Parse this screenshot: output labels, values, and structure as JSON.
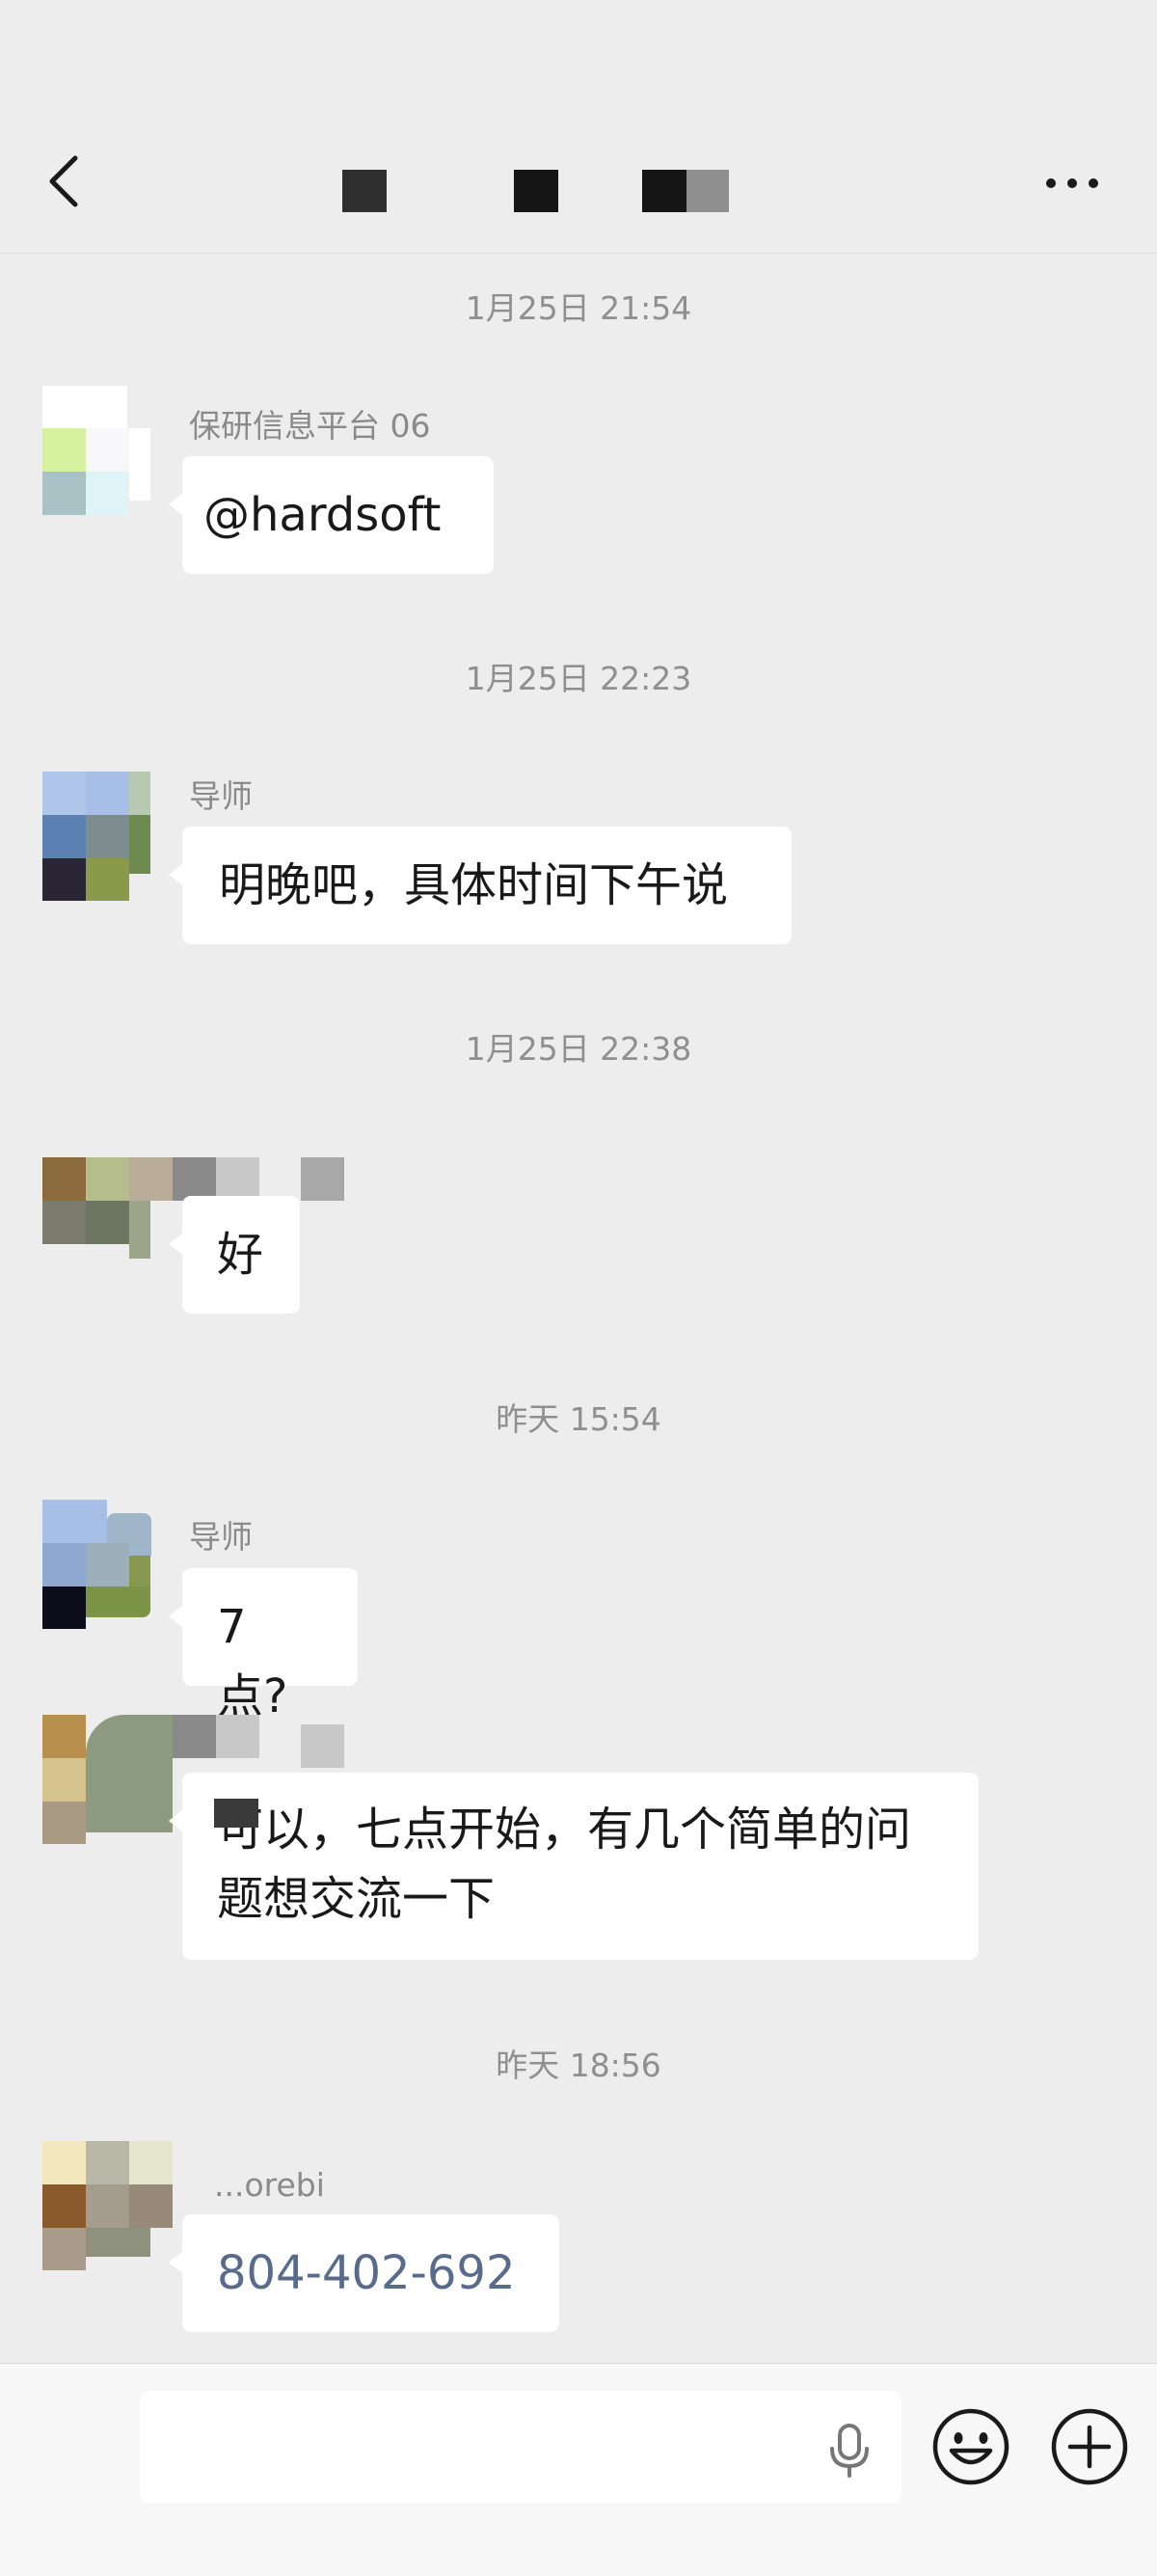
{
  "header": {
    "back_icon": "chevron-left-icon",
    "more_icon": "more-dots-icon"
  },
  "messages": [
    {
      "time": "1月25日 21:54",
      "sender": "保研信息平台 06",
      "text": "@hardsoft"
    },
    {
      "time": "1月25日 22:23",
      "sender": "导师",
      "text": "明晚吧，具体时间下午说"
    },
    {
      "time": "1月25日 22:38",
      "sender": "",
      "text": "好"
    },
    {
      "time": "昨天 15:54",
      "sender": "导师",
      "text": "7 点?"
    },
    {
      "time": "",
      "sender": "",
      "text": "可以，七点开始，有几个简单的问\n题想交流一下"
    },
    {
      "time": "昨天 18:56",
      "sender": "...orebi",
      "text": "804-402-692"
    }
  ],
  "input_bar": {
    "placeholder": "",
    "voice_icon": "microphone-icon",
    "emoji_icon": "emoji-smile-icon",
    "add_icon": "plus-circle-icon"
  },
  "colors": {
    "background": "#ededed",
    "bubble": "#ffffff",
    "link": "#586b8d",
    "timestamp": "#8f8f8f"
  }
}
